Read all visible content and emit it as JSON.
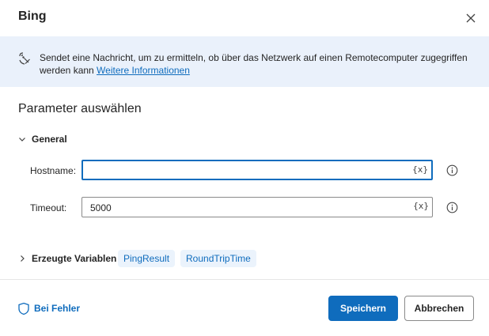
{
  "dialog": {
    "title": "Bing",
    "close_icon": "close-icon"
  },
  "info": {
    "icon": "ping-icon",
    "text": "Sendet eine Nachricht, um zu ermitteln, ob über das Netzwerk auf einen Remotecomputer zugegriffen werden kann ",
    "link": "Weitere Informationen"
  },
  "params": {
    "section_title": "Parameter auswählen",
    "group_label": "General",
    "fields": [
      {
        "label": "Hostname:",
        "value": "",
        "var_button": "{x}"
      },
      {
        "label": "Timeout:",
        "value": "5000",
        "var_button": "{x}"
      }
    ]
  },
  "variables": {
    "label": "Erzeugte Variablen",
    "items": [
      "PingResult",
      "RoundTripTime"
    ]
  },
  "footer": {
    "on_error": "Bei Fehler",
    "save": "Speichern",
    "cancel": "Abbrechen"
  },
  "colors": {
    "accent": "#0f6cbd",
    "banner_bg": "#eaf1fb",
    "chip_bg": "#ebf3fc"
  }
}
